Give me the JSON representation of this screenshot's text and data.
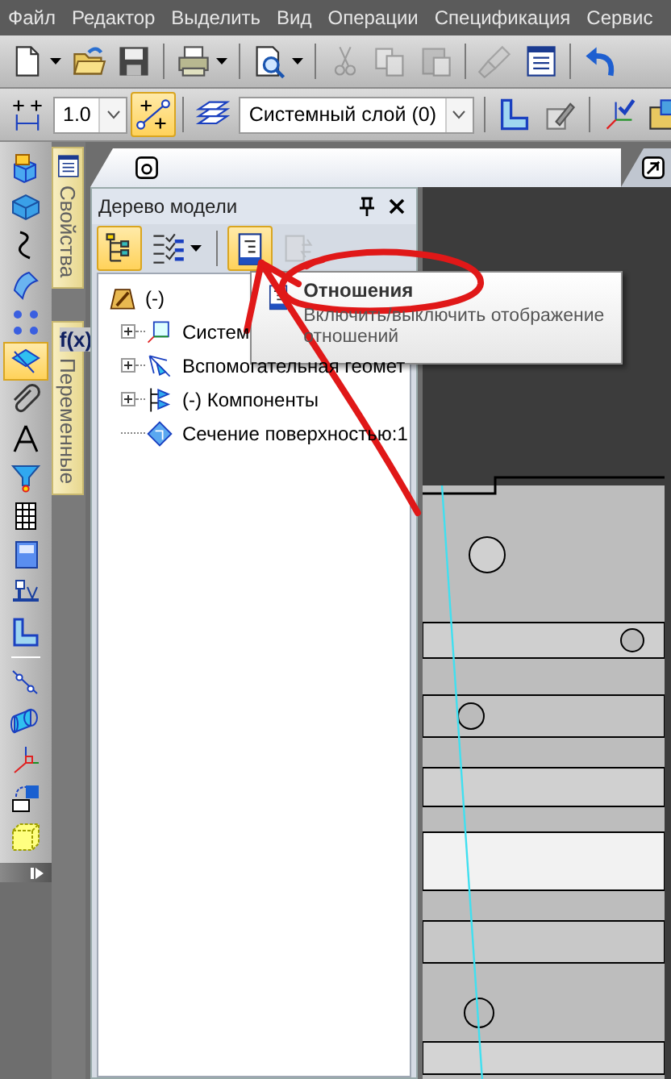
{
  "menu": [
    "Файл",
    "Редактор",
    "Выделить",
    "Вид",
    "Операции",
    "Спецификация",
    "Сервис"
  ],
  "toolbar_1": [
    {
      "kind": "new",
      "dropdown": true,
      "disabled": false
    },
    {
      "kind": "open",
      "dropdown": false,
      "disabled": false
    },
    {
      "kind": "save",
      "dropdown": false,
      "disabled": false
    },
    {
      "kind": "separator"
    },
    {
      "kind": "print",
      "dropdown": true,
      "disabled": false
    },
    {
      "kind": "separator"
    },
    {
      "kind": "preview",
      "dropdown": true,
      "disabled": false
    },
    {
      "kind": "separator"
    },
    {
      "kind": "cut",
      "dropdown": false,
      "disabled": true
    },
    {
      "kind": "copy",
      "dropdown": false,
      "disabled": true
    },
    {
      "kind": "paste",
      "dropdown": false,
      "disabled": true
    },
    {
      "kind": "separator"
    },
    {
      "kind": "brush",
      "dropdown": false,
      "disabled": true
    },
    {
      "kind": "list",
      "dropdown": false,
      "disabled": false
    },
    {
      "kind": "separator"
    },
    {
      "kind": "undo",
      "dropdown": false,
      "disabled": false
    }
  ],
  "toolbar_2": [
    {
      "kind": "dimension",
      "selected": false
    },
    {
      "kind": "combo",
      "value": "1.0"
    },
    {
      "kind": "snap",
      "selected": true
    },
    {
      "kind": "separator"
    },
    {
      "kind": "layers",
      "selected": false
    },
    {
      "kind": "combo",
      "value": "Системный слой (0)"
    },
    {
      "kind": "separator"
    },
    {
      "kind": "sketch",
      "selected": false
    },
    {
      "kind": "edit",
      "selected": false
    },
    {
      "kind": "separator"
    },
    {
      "kind": "axes",
      "selected": false
    },
    {
      "kind": "partial",
      "selected": false
    }
  ],
  "left_toolbar": [
    {
      "kind": "cube",
      "selected": false
    },
    {
      "kind": "block",
      "selected": false
    },
    {
      "kind": "curve",
      "selected": false
    },
    {
      "kind": "surface",
      "selected": false
    },
    {
      "kind": "dots",
      "selected": false
    },
    {
      "kind": "plane",
      "selected": true
    },
    {
      "kind": "paperclip",
      "selected": false
    },
    {
      "kind": "compass",
      "selected": false
    },
    {
      "kind": "funnel",
      "selected": false
    },
    {
      "kind": "table",
      "selected": false
    },
    {
      "kind": "book",
      "selected": false
    },
    {
      "kind": "mark",
      "selected": false
    },
    {
      "kind": "bracket",
      "selected": false
    },
    {
      "kind": "separator"
    },
    {
      "kind": "line",
      "selected": false
    },
    {
      "kind": "cylinder",
      "selected": false
    },
    {
      "kind": "axes3",
      "selected": false
    },
    {
      "kind": "insert",
      "selected": false
    },
    {
      "kind": "box",
      "selected": false
    }
  ],
  "side_tabs": [
    {
      "label": "Свойства",
      "kind": "properties"
    },
    {
      "label": "Переменные",
      "kind": "variables",
      "icon_text": "f(x)"
    }
  ],
  "document_tabs": [
    {
      "kind": "part",
      "selected": true
    },
    {
      "kind": "drawing",
      "selected": false
    }
  ],
  "model_tree": {
    "title": "Дерево модели",
    "toolbar": [
      {
        "kind": "tree",
        "selected": true,
        "dropdown": false,
        "disabled": false
      },
      {
        "kind": "checklist",
        "selected": false,
        "dropdown": true,
        "disabled": false
      },
      {
        "kind": "separator"
      },
      {
        "kind": "relations",
        "selected": true,
        "dropdown": false,
        "disabled": false
      },
      {
        "kind": "rebuild",
        "selected": false,
        "dropdown": false,
        "disabled": true
      }
    ],
    "tree": [
      {
        "label": "(-)",
        "kind": "part",
        "expandable": false,
        "children": [
          {
            "label": "Систем",
            "kind": "csys",
            "expandable": true,
            "expanded": false
          },
          {
            "label": "Вспомогательная геомет",
            "kind": "aux",
            "expandable": true,
            "expanded": false
          },
          {
            "label": "(-) Компоненты",
            "kind": "components",
            "expandable": true,
            "expanded": false
          },
          {
            "label": "Сечение поверхностью:1",
            "kind": "section",
            "expandable": false
          }
        ]
      }
    ]
  },
  "tooltip": {
    "title": "Отношения",
    "text": "Включить/выключить отображение отношений"
  }
}
